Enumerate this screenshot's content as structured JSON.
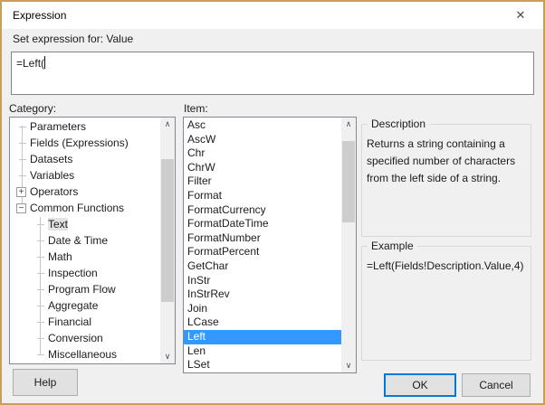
{
  "window": {
    "title": "Expression",
    "close_icon": "✕"
  },
  "header": {
    "set_expression_label": "Set expression for: Value"
  },
  "editor": {
    "value": "=Left("
  },
  "category": {
    "label": "Category:",
    "tree": [
      {
        "label": "Parameters",
        "glyph": "",
        "level": 0,
        "selected": false
      },
      {
        "label": "Fields (Expressions)",
        "glyph": "",
        "level": 0,
        "selected": false
      },
      {
        "label": "Datasets",
        "glyph": "",
        "level": 0,
        "selected": false
      },
      {
        "label": "Variables",
        "glyph": "",
        "level": 0,
        "selected": false
      },
      {
        "label": "Operators",
        "glyph": "+",
        "level": 0,
        "selected": false
      },
      {
        "label": "Common Functions",
        "glyph": "−",
        "level": 0,
        "selected": false
      },
      {
        "label": "Text",
        "glyph": "",
        "level": 1,
        "selected": true
      },
      {
        "label": "Date & Time",
        "glyph": "",
        "level": 1,
        "selected": false
      },
      {
        "label": "Math",
        "glyph": "",
        "level": 1,
        "selected": false
      },
      {
        "label": "Inspection",
        "glyph": "",
        "level": 1,
        "selected": false
      },
      {
        "label": "Program Flow",
        "glyph": "",
        "level": 1,
        "selected": false
      },
      {
        "label": "Aggregate",
        "glyph": "",
        "level": 1,
        "selected": false
      },
      {
        "label": "Financial",
        "glyph": "",
        "level": 1,
        "selected": false
      },
      {
        "label": "Conversion",
        "glyph": "",
        "level": 1,
        "selected": false
      },
      {
        "label": "Miscellaneous",
        "glyph": "",
        "level": 1,
        "selected": false
      }
    ]
  },
  "items": {
    "label": "Item:",
    "selected_index": 15,
    "list": [
      "Asc",
      "AscW",
      "Chr",
      "ChrW",
      "Filter",
      "Format",
      "FormatCurrency",
      "FormatDateTime",
      "FormatNumber",
      "FormatPercent",
      "GetChar",
      "InStr",
      "InStrRev",
      "Join",
      "LCase",
      "Left",
      "Len",
      "LSet"
    ]
  },
  "description": {
    "title": "Description",
    "body": "Returns a string containing a specified number of characters from the left side of a string."
  },
  "example": {
    "title": "Example",
    "body": "=Left(Fields!Description.Value,4)"
  },
  "footer": {
    "help": "Help",
    "ok": "OK",
    "cancel": "Cancel"
  },
  "icons": {
    "scroll_up": "∧",
    "scroll_down": "∨"
  },
  "colors": {
    "accent_border": "#c99e58",
    "list_selection": "#3399ff",
    "ok_border": "#0078d7"
  }
}
